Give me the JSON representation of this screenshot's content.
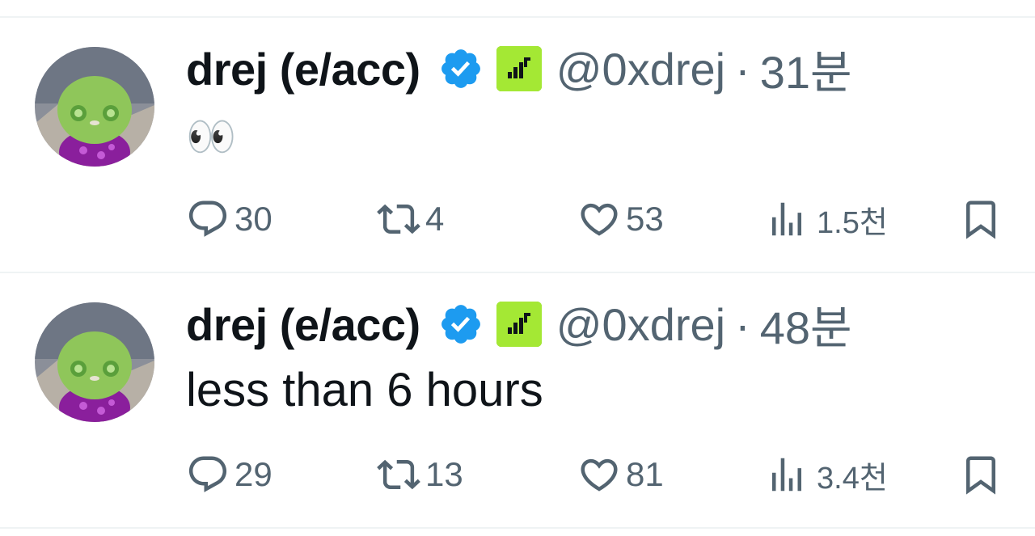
{
  "tweets": [
    {
      "name": "drej (e/acc)",
      "handle": "@0xdrej",
      "separator": "·",
      "time": "31분",
      "text": "👀",
      "replies": "30",
      "retweets": "4",
      "likes": "53",
      "views": "1.5천"
    },
    {
      "name": "drej (e/acc)",
      "handle": "@0xdrej",
      "separator": "·",
      "time": "48분",
      "text": "less than 6 hours",
      "replies": "29",
      "retweets": "13",
      "likes": "81",
      "views": "3.4천"
    }
  ],
  "colors": {
    "verified": "#1d9bf0",
    "affiliate_badge": "#a4e834",
    "secondary_text": "#536471",
    "divider": "#eff3f4"
  },
  "icons": [
    "verified-badge-icon",
    "affiliate-badge-icon",
    "reply-icon",
    "retweet-icon",
    "like-icon",
    "views-icon",
    "bookmark-icon"
  ]
}
